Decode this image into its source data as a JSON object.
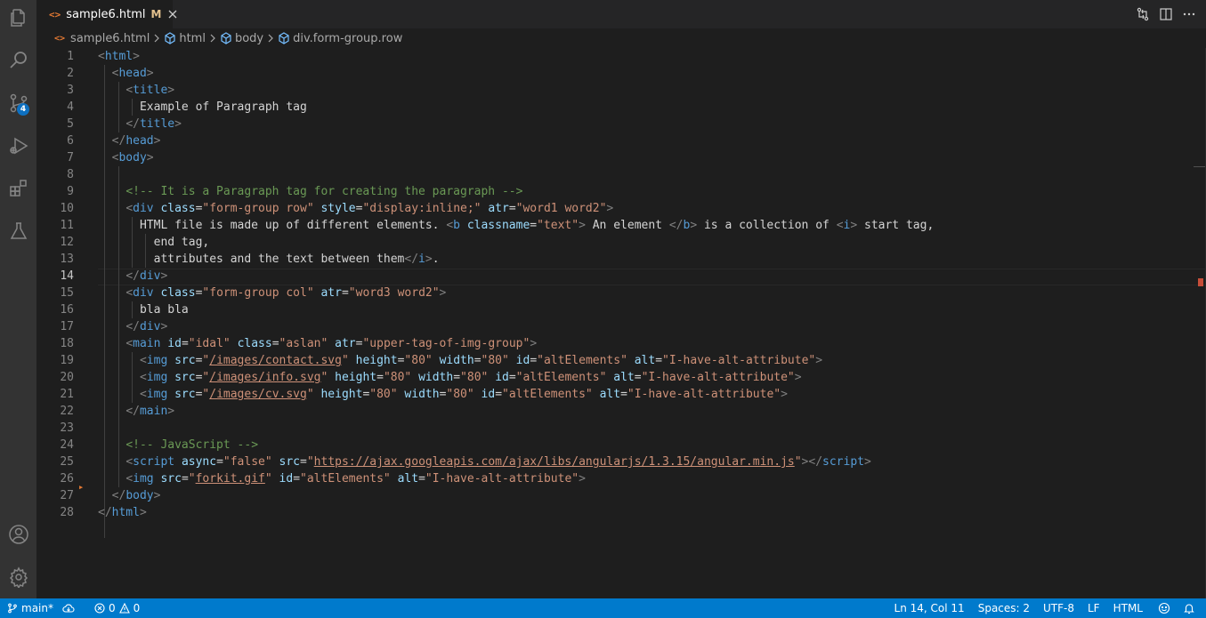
{
  "tab": {
    "filename": "sample6.html",
    "modified_flag": "M",
    "file_icon": "<>"
  },
  "breadcrumbs": [
    "sample6.html",
    "html",
    "body",
    "div.form-group.row"
  ],
  "activity_bar": {
    "items": [
      "explorer-icon",
      "search-icon",
      "source-control-icon",
      "run-debug-icon",
      "extensions-icon",
      "testing-icon"
    ],
    "source_control_badge": "4",
    "bottom_items": [
      "accounts-icon",
      "manage-gear-icon"
    ]
  },
  "editor": {
    "current_line": 14,
    "line_numbers": [
      "1",
      "2",
      "3",
      "4",
      "5",
      "6",
      "7",
      "8",
      "9",
      "10",
      "11",
      "12",
      "13",
      "14",
      "15",
      "16",
      "17",
      "18",
      "19",
      "20",
      "21",
      "22",
      "23",
      "24",
      "25",
      "26",
      "27",
      "28"
    ]
  },
  "status_bar": {
    "branch": "main*",
    "errors": "0",
    "warnings": "0",
    "cursor_position": "Ln 14, Col 11",
    "indentation": "Spaces: 2",
    "encoding": "UTF-8",
    "line_ending": "LF",
    "language": "HTML"
  },
  "colors": {
    "accent": "#007acc",
    "tag": "#569cd6",
    "attribute": "#9cdcfe",
    "string": "#ce9178",
    "comment": "#6a9955"
  }
}
